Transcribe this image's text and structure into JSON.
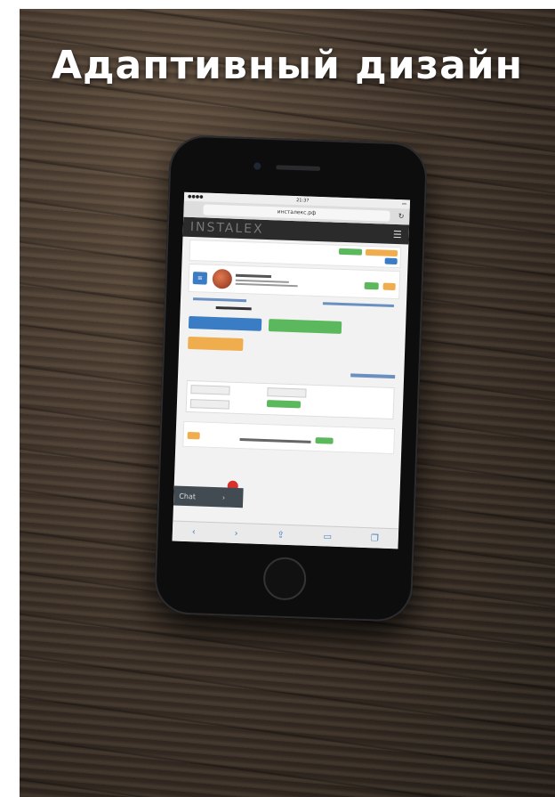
{
  "banner": {
    "title": "Адаптивный дизайн"
  },
  "browser": {
    "status_time": "21:37",
    "url": "инсталекс.рф"
  },
  "app": {
    "logo": "INSTALEX"
  },
  "chat": {
    "label": "Chat"
  },
  "colors": {
    "accent_blue": "#3b7dc4",
    "accent_green": "#5cb85c",
    "accent_orange": "#f0ad4e"
  }
}
